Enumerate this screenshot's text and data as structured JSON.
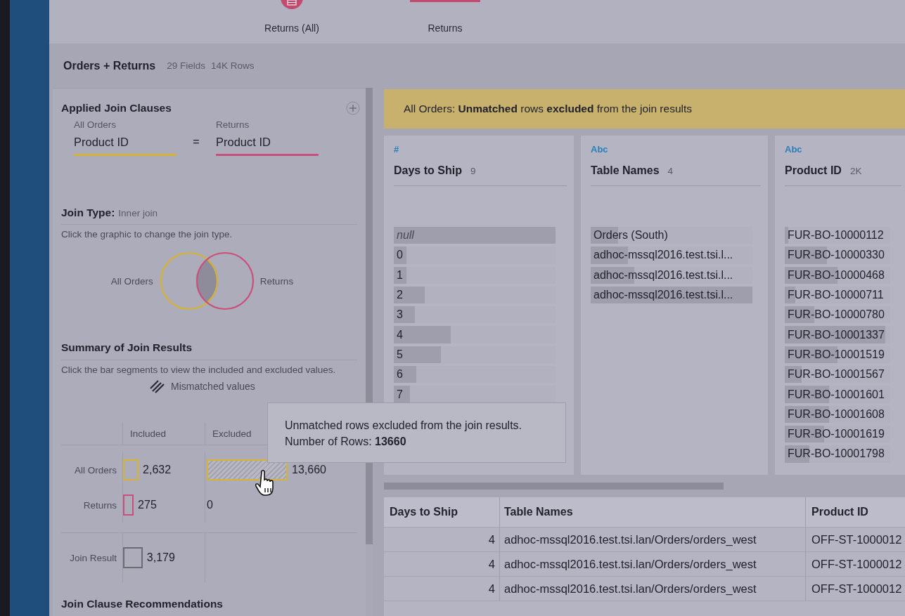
{
  "flow_nodes": [
    {
      "label": "Returns (All)",
      "kind": "circle"
    },
    {
      "label": "Returns",
      "kind": "bar"
    }
  ],
  "step": {
    "title": "Orders + Returns",
    "fields": "29 Fields",
    "rows": "14K Rows"
  },
  "join_clauses": {
    "title": "Applied Join Clauses",
    "left": {
      "table": "All Orders",
      "field": "Product ID"
    },
    "operator": "=",
    "right": {
      "table": "Returns",
      "field": "Product ID"
    }
  },
  "join_type": {
    "label": "Join Type:",
    "value": "Inner join",
    "hint": "Click the graphic to change the join type.",
    "left_label": "All Orders",
    "right_label": "Returns"
  },
  "summary": {
    "title": "Summary of Join Results",
    "hint": "Click the bar segments to view the included and excluded values.",
    "legend": "Mismatched values",
    "columns": [
      "Included",
      "Excluded"
    ],
    "rows": [
      {
        "label": "All Orders",
        "color": "#d4b336",
        "included": {
          "text": "2,632",
          "level": 0.19
        },
        "excluded": {
          "text": "13,660",
          "level": 1
        }
      },
      {
        "label": "Returns",
        "color": "#c8507a",
        "included": {
          "text": "275",
          "level": 0.13
        },
        "excluded": {
          "text": "0",
          "level": 0
        }
      },
      {
        "label": "Join Result",
        "color": "#6e6a72",
        "included": {
          "text": "3,179",
          "level": 0.24
        }
      }
    ]
  },
  "recommendations_title": "Join Clause Recommendations",
  "banner": "All Orders: **Unmatched** rows **excluded** from the join results",
  "profile_cards": [
    {
      "type": "#",
      "name": "Days to Ship",
      "count": "9",
      "values": [
        {
          "text": "null",
          "kind": "null",
          "level": 1
        },
        {
          "text": "0",
          "kind": "value",
          "level": 0.08
        },
        {
          "text": "1",
          "kind": "value",
          "level": 0.08
        },
        {
          "text": "2",
          "kind": "value",
          "level": 0.19
        },
        {
          "text": "3",
          "kind": "value",
          "level": 0.13
        },
        {
          "text": "4",
          "kind": "value",
          "level": 0.35
        },
        {
          "text": "5",
          "kind": "value",
          "level": 0.29
        },
        {
          "text": "6",
          "kind": "value",
          "level": 0.14
        },
        {
          "text": "7",
          "kind": "value",
          "level": 0.1
        }
      ]
    },
    {
      "type": "Abc",
      "name": "Table Names",
      "count": "4",
      "values": [
        {
          "text": "Orders (South)",
          "kind": "value",
          "level": 0.17
        },
        {
          "text": "adhoc-mssql2016.test.tsi.l...",
          "kind": "value",
          "level": 0.23
        },
        {
          "text": "adhoc-mssql2016.test.tsi.l...",
          "kind": "value",
          "level": 0.27
        },
        {
          "text": "adhoc-mssql2016.test.tsi.l...",
          "kind": "value",
          "level": 1
        }
      ]
    },
    {
      "type": "Abc",
      "name": "Product ID",
      "count": "2K",
      "values": [
        {
          "text": "FUR-BO-10000112",
          "kind": "value",
          "level": 0.03
        },
        {
          "text": "FUR-BO-10000330",
          "kind": "value",
          "level": 0.4
        },
        {
          "text": "FUR-BO-10000468",
          "kind": "value",
          "level": 0.5
        },
        {
          "text": "FUR-BO-10000711",
          "kind": "value",
          "level": 0.1
        },
        {
          "text": "FUR-BO-10000780",
          "kind": "value",
          "level": 0.28
        },
        {
          "text": "FUR-BO-10001337",
          "kind": "value",
          "level": 0.95
        },
        {
          "text": "FUR-BO-10001519",
          "kind": "value",
          "level": 0.5
        },
        {
          "text": "FUR-BO-10001567",
          "kind": "value",
          "level": 0.16
        },
        {
          "text": "FUR-BO-10001601",
          "kind": "value",
          "level": 0.42
        },
        {
          "text": "FUR-BO-10001608",
          "kind": "value",
          "level": 0.42
        },
        {
          "text": "FUR-BO-10001619",
          "kind": "value",
          "level": 0.37
        },
        {
          "text": "FUR-BO-10001798",
          "kind": "value",
          "level": 0.23
        }
      ]
    }
  ],
  "tooltip": {
    "line1": "Unmatched rows excluded from the join results.",
    "line2": "Number of Rows: **13660**"
  },
  "grid": {
    "columns": [
      "Days to Ship",
      "Table Names",
      "Product ID"
    ],
    "rows": [
      [
        "4",
        "adhoc-mssql2016.test.tsi.lan/Orders/orders_west",
        "OFF-ST-1000012"
      ],
      [
        "4",
        "adhoc-mssql2016.test.tsi.lan/Orders/orders_west",
        "OFF-ST-1000012"
      ],
      [
        "4",
        "adhoc-mssql2016.test.tsi.lan/Orders/orders_west",
        "OFF-ST-1000012"
      ]
    ]
  }
}
